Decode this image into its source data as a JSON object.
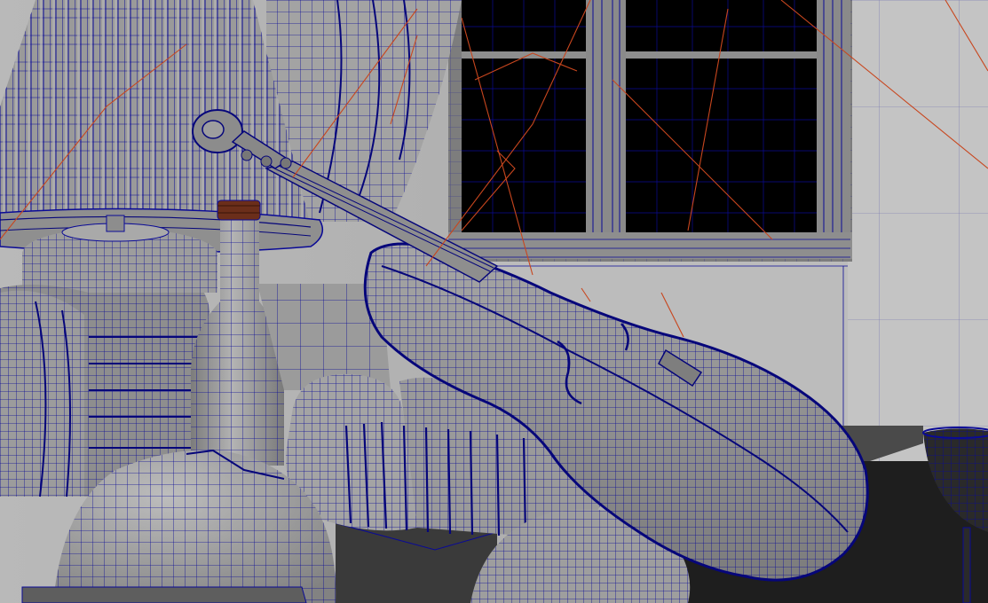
{
  "viewport": {
    "shading_mode": "wireframe-on-shaded",
    "colors": {
      "wire": "#0a0a96",
      "wire_dense": "#06067a",
      "shaded_light": "#a9a9a9",
      "shaded_mid": "#8c8c8c",
      "shaded_dark": "#6e6e6e",
      "wall": "#b4b4b4",
      "wall_bright": "#c9c9c9",
      "night": "#000000",
      "floor": "#1e1e1e",
      "table_edge": "#3a3a3a",
      "cork": "#6b2e1a",
      "light_line": "#c8461e"
    }
  },
  "scene": {
    "objects": [
      {
        "id": "lamp-shade",
        "icon": "lamp-shade-mesh-icon"
      },
      {
        "id": "curtain",
        "icon": "curtain-mesh-icon"
      },
      {
        "id": "window",
        "icon": "window-mesh-icon"
      },
      {
        "id": "violin",
        "icon": "violin-mesh-icon"
      },
      {
        "id": "wine-bottle",
        "icon": "bottle-mesh-icon"
      },
      {
        "id": "sugar-bowl",
        "icon": "bowl-mesh-icon"
      },
      {
        "id": "cushion-stack",
        "icon": "cushion-mesh-icon"
      },
      {
        "id": "boxing-gloves",
        "icon": "glove-mesh-icon"
      },
      {
        "id": "bread-loaf",
        "icon": "bread-mesh-icon"
      },
      {
        "id": "apple",
        "icon": "fruit-mesh-icon"
      },
      {
        "id": "wine-glass",
        "icon": "glass-mesh-icon"
      },
      {
        "id": "light-rays",
        "icon": "light-gizmo-icon"
      }
    ]
  }
}
